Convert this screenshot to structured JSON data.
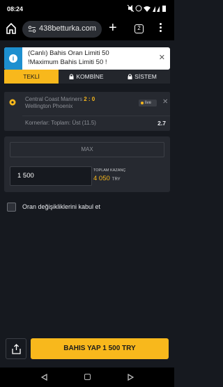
{
  "status_bar": {
    "time": "08:24",
    "icons": [
      "mute-icon",
      "alarm-icon",
      "wifi-icon",
      "signal-icon",
      "signal-icon",
      "battery-icon"
    ]
  },
  "browser": {
    "url": "438betturka.com",
    "tab_count": "2"
  },
  "notice": {
    "line1": "(Canlı) Bahis Oran Limiti 50",
    "line2": "!Maximum Bahis Limiti 50 !"
  },
  "tabs": [
    {
      "label": "TEKLİ",
      "active": true
    },
    {
      "label": "KOMBİNE",
      "active": false
    },
    {
      "label": "SİSTEM",
      "active": false
    }
  ],
  "bet": {
    "home_team": "Central Coast Mariners",
    "score": "2 : 0",
    "away_team": "Wellington Phoenix",
    "live_label": "live",
    "market": "Korner‌lar: Toplam: Üst (11.5)",
    "odd": "2.7"
  },
  "stake": {
    "max_label": "MAX",
    "amount": "1 500",
    "total_win_label": "TOPLAM KAZANÇ",
    "total_win_value": "4 050",
    "currency": "TRY"
  },
  "accept_changes_label": "Oran değişikliklerini kabul et",
  "place_bet_label": "BAHIS YAP 1 500 TRY",
  "colors": {
    "accent": "#f8b81c",
    "background": "#16191f",
    "card": "#262930"
  }
}
